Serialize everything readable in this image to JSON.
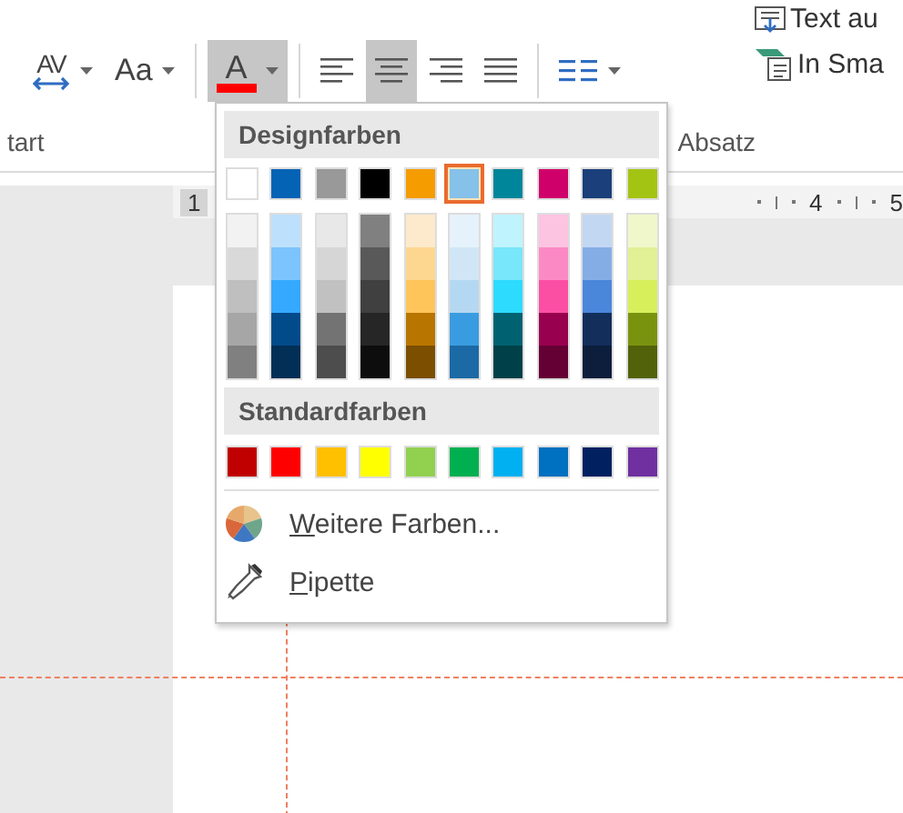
{
  "ribbon": {
    "top_labels": [
      "Text au",
      "In Sma"
    ],
    "tools": [
      {
        "kind": "spacing",
        "label": "AV",
        "caret": true,
        "selected": false
      },
      {
        "kind": "case",
        "label": "Aa",
        "caret": true,
        "selected": false
      },
      {
        "kind": "fontcolor",
        "label": "A",
        "color": "#ff0000",
        "caret": true,
        "selected": true
      },
      {
        "kind": "align-left",
        "caret": false,
        "selected": false
      },
      {
        "kind": "align-center",
        "caret": false,
        "selected": true
      },
      {
        "kind": "align-right",
        "caret": false,
        "selected": false
      },
      {
        "kind": "justify",
        "caret": false,
        "selected": false
      },
      {
        "kind": "columns",
        "caret": true,
        "selected": false
      }
    ],
    "group_labels": [
      "tart",
      "Absatz"
    ]
  },
  "ruler": {
    "left_label": "1",
    "right_labels": [
      "4",
      "5"
    ]
  },
  "color_menu": {
    "theme_title": "Designfarben",
    "theme_colors": [
      {
        "color": "#ffffff",
        "selected": false
      },
      {
        "color": "#0563b5",
        "selected": false
      },
      {
        "color": "#999999",
        "selected": false
      },
      {
        "color": "#000000",
        "selected": false
      },
      {
        "color": "#f59c00",
        "selected": false
      },
      {
        "color": "#85c1e9",
        "selected": true
      },
      {
        "color": "#00869a",
        "selected": false
      },
      {
        "color": "#d0006b",
        "selected": false
      },
      {
        "color": "#1a3f7a",
        "selected": false
      },
      {
        "color": "#a4c414",
        "selected": false
      }
    ],
    "theme_shades": [
      {
        "shades": [
          {
            "color": "#f2f2f2"
          },
          {
            "color": "#d9d9d9"
          },
          {
            "color": "#bfbfbf"
          },
          {
            "color": "#a6a6a6"
          },
          {
            "color": "#808080"
          }
        ]
      },
      {
        "shades": [
          {
            "color": "#bde0fd"
          },
          {
            "color": "#7cc4fe"
          },
          {
            "color": "#35a9ff"
          },
          {
            "color": "#024b8a"
          },
          {
            "color": "#022f56"
          }
        ]
      },
      {
        "shades": [
          {
            "color": "#e8e8e8"
          },
          {
            "color": "#d6d6d6"
          },
          {
            "color": "#c1c1c1"
          },
          {
            "color": "#737373"
          },
          {
            "color": "#4d4d4d"
          }
        ]
      },
      {
        "shades": [
          {
            "color": "#808080"
          },
          {
            "color": "#595959"
          },
          {
            "color": "#404040"
          },
          {
            "color": "#262626"
          },
          {
            "color": "#0d0d0d"
          }
        ]
      },
      {
        "shades": [
          {
            "color": "#fde9cc"
          },
          {
            "color": "#fdd790"
          },
          {
            "color": "#fec55b"
          },
          {
            "color": "#b87600"
          },
          {
            "color": "#7b4e00"
          }
        ]
      },
      {
        "shades": [
          {
            "color": "#e6f2fb"
          },
          {
            "color": "#d0e6f7"
          },
          {
            "color": "#b5d8f2"
          },
          {
            "color": "#3a9ce0"
          },
          {
            "color": "#1b6aa5"
          }
        ]
      },
      {
        "shades": [
          {
            "color": "#bff3fd"
          },
          {
            "color": "#78e6fb"
          },
          {
            "color": "#2ddbfe"
          },
          {
            "color": "#006271"
          },
          {
            "color": "#004048"
          }
        ]
      },
      {
        "shades": [
          {
            "color": "#fdc4e2"
          },
          {
            "color": "#fb8ac4"
          },
          {
            "color": "#fb4fa4"
          },
          {
            "color": "#98004f"
          },
          {
            "color": "#650034"
          }
        ]
      },
      {
        "shades": [
          {
            "color": "#c2d7f2"
          },
          {
            "color": "#84ade5"
          },
          {
            "color": "#4a86da"
          },
          {
            "color": "#132e5a"
          },
          {
            "color": "#0c1e3c"
          }
        ]
      },
      {
        "shades": [
          {
            "color": "#f0f8cb"
          },
          {
            "color": "#e2f096"
          },
          {
            "color": "#d6ef5b"
          },
          {
            "color": "#7a930f"
          },
          {
            "color": "#52620a"
          }
        ]
      }
    ],
    "standard_title": "Standardfarben",
    "standard_colors": [
      {
        "color": "#c00000"
      },
      {
        "color": "#ff0000"
      },
      {
        "color": "#ffc000"
      },
      {
        "color": "#ffff00"
      },
      {
        "color": "#92d050"
      },
      {
        "color": "#00b050"
      },
      {
        "color": "#00b0f0"
      },
      {
        "color": "#0070c0"
      },
      {
        "color": "#002060"
      },
      {
        "color": "#7030a0"
      }
    ],
    "items": [
      {
        "kind": "more",
        "label": "Weitere Farben..."
      },
      {
        "kind": "eyedropper",
        "label": "Pipette"
      }
    ]
  }
}
